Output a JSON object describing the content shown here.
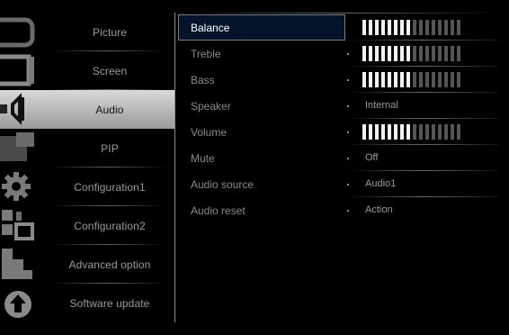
{
  "left_menu": {
    "items": [
      {
        "label": "Picture",
        "icon": "picture-icon",
        "active": false
      },
      {
        "label": "Screen",
        "icon": "screen-icon",
        "active": false
      },
      {
        "label": "Audio",
        "icon": "speaker-icon",
        "active": true
      },
      {
        "label": "PIP",
        "icon": "pip-icon",
        "active": false
      },
      {
        "label": "Configuration1",
        "icon": "gear-icon",
        "active": false
      },
      {
        "label": "Configuration2",
        "icon": "configuration2-icon",
        "active": false
      },
      {
        "label": "Advanced option",
        "icon": "advanced-option-icon",
        "active": false
      },
      {
        "label": "Software update",
        "icon": "upload-arrow-icon",
        "active": false
      }
    ]
  },
  "audio_settings": {
    "rows": [
      {
        "name": "Balance",
        "type": "bar",
        "level_fraction": 0.5,
        "selected": true
      },
      {
        "name": "Treble",
        "type": "bar",
        "level_fraction": 0.5,
        "selected": false
      },
      {
        "name": "Bass",
        "type": "bar",
        "level_fraction": 0.5,
        "selected": false
      },
      {
        "name": "Speaker",
        "type": "text",
        "value": "Internal",
        "selected": false
      },
      {
        "name": "Volume",
        "type": "bar",
        "level_fraction": 0.5,
        "selected": false
      },
      {
        "name": "Mute",
        "type": "text",
        "value": "Off",
        "selected": false
      },
      {
        "name": "Audio source",
        "type": "text",
        "value": "Audio1",
        "selected": false
      },
      {
        "name": "Audio reset",
        "type": "text",
        "value": "Action",
        "selected": false
      }
    ],
    "bar_segments": 16
  },
  "colors": {
    "background": "#000000",
    "active_menu_bg": "#c8c8c8",
    "selected_row_bg": "#05142a",
    "bar_on": "#f2f2f2",
    "bar_off": "#555555"
  }
}
